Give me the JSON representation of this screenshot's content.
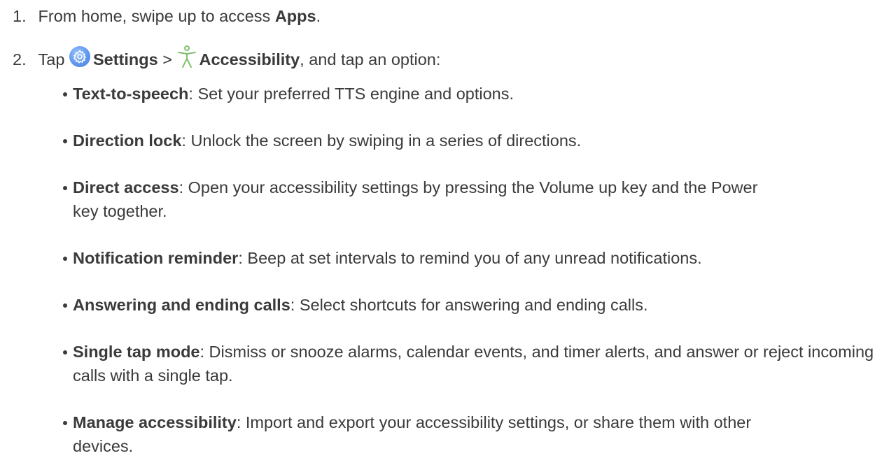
{
  "steps": [
    {
      "number": "1.",
      "pre": "From home, swipe up to access ",
      "bold": "Apps",
      "post": "."
    },
    {
      "number": "2.",
      "pre": "Tap ",
      "settings_icon": "settings-gear-icon",
      "settings_label": "Settings",
      "separator": " > ",
      "accessibility_icon": "accessibility-person-icon",
      "accessibility_label": "Accessibility",
      "post": ", and tap an option:"
    }
  ],
  "options": [
    {
      "title": "Text-to-speech",
      "desc": ": Set your preferred TTS engine and options."
    },
    {
      "title": "Direction lock",
      "desc": ": Unlock the screen by swiping in a series of directions."
    },
    {
      "title": "Direct access",
      "desc": ": Open your accessibility settings by pressing the Volume up key and the Power key together."
    },
    {
      "title": "Notification reminder",
      "desc": ": Beep at set intervals to remind you of any unread notifications."
    },
    {
      "title": "Answering and ending calls",
      "desc": ": Select shortcuts for answering and ending calls."
    },
    {
      "title": "Single tap mode",
      "desc": ": Dismiss or snooze alarms, calendar events, and timer alerts, and answer or reject incoming calls with a single tap."
    },
    {
      "title": "Manage accessibility",
      "desc": ": Import and export your accessibility settings, or share them with other devices."
    }
  ]
}
